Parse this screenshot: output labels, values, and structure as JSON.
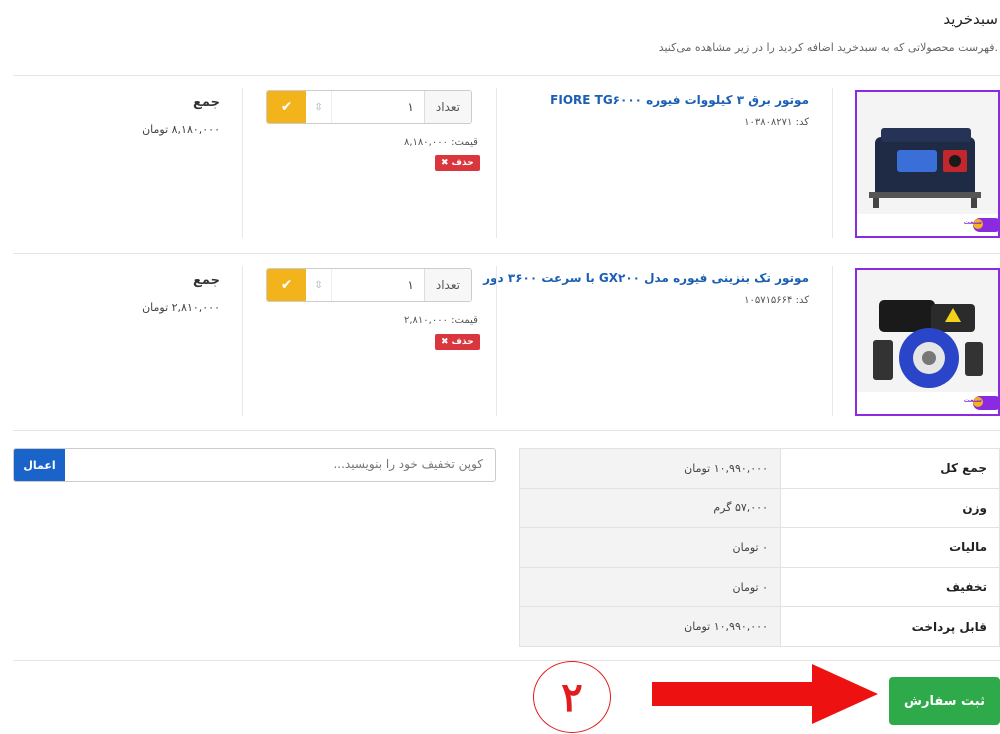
{
  "header": {
    "title": "سبدخرید",
    "description": "فهرست محصولاتی که به سبدخرید اضافه کردید را در زیر مشاهده می‌کنید."
  },
  "cart_items": [
    {
      "name": "موتور برق ۳ کیلووات فیوره FIORE TG۶۰۰۰",
      "code_label": "کد:",
      "code": "۱۰۳۸۰۸۲۷۱",
      "quantity_label": "تعداد",
      "quantity": "۱",
      "price_label": "قیمت:",
      "price": "۸,۱۸۰,۰۰۰",
      "delete_label": "حذف",
      "sum_label": "جمع",
      "sum_value": "۸,۱۸۰,۰۰۰ تومان"
    },
    {
      "name": "موتور تک بنزینی فیوره مدل GX۲۰۰ با سرعت ۳۶۰۰ دور",
      "code_label": "کد:",
      "code": "۱۰۵۷۱۵۶۶۴",
      "quantity_label": "تعداد",
      "quantity": "۱",
      "price_label": "قیمت:",
      "price": "۲,۸۱۰,۰۰۰",
      "delete_label": "حذف",
      "sum_label": "جمع",
      "sum_value": "۲,۸۱۰,۰۰۰ تومان"
    }
  ],
  "coupon": {
    "placeholder": "کوپن تخفیف خود را بنویسید...",
    "apply_label": "اعمال"
  },
  "totals": [
    {
      "label": "جمع کل",
      "value": "۱۰,۹۹۰,۰۰۰ تومان"
    },
    {
      "label": "وزن",
      "value": "۵۷,۰۰۰ گرم"
    },
    {
      "label": "مالیات",
      "value": "۰ تومان"
    },
    {
      "label": "تخفیف",
      "value": "۰ تومان"
    },
    {
      "label": "قابل پرداخت",
      "value": "۱۰,۹۹۰,۰۰۰ تومان"
    }
  ],
  "submit_label": "ثبت سفارش",
  "step_number": "۲",
  "brand_label": "آتر سنعت",
  "colors": {
    "accent_yellow": "#f2b31b",
    "delete_red": "#d9363e",
    "submit_green": "#2eaa4a",
    "apply_blue": "#1a64c9",
    "image_border_purple": "#8a2be2",
    "annotation_red": "#e21c1c"
  }
}
